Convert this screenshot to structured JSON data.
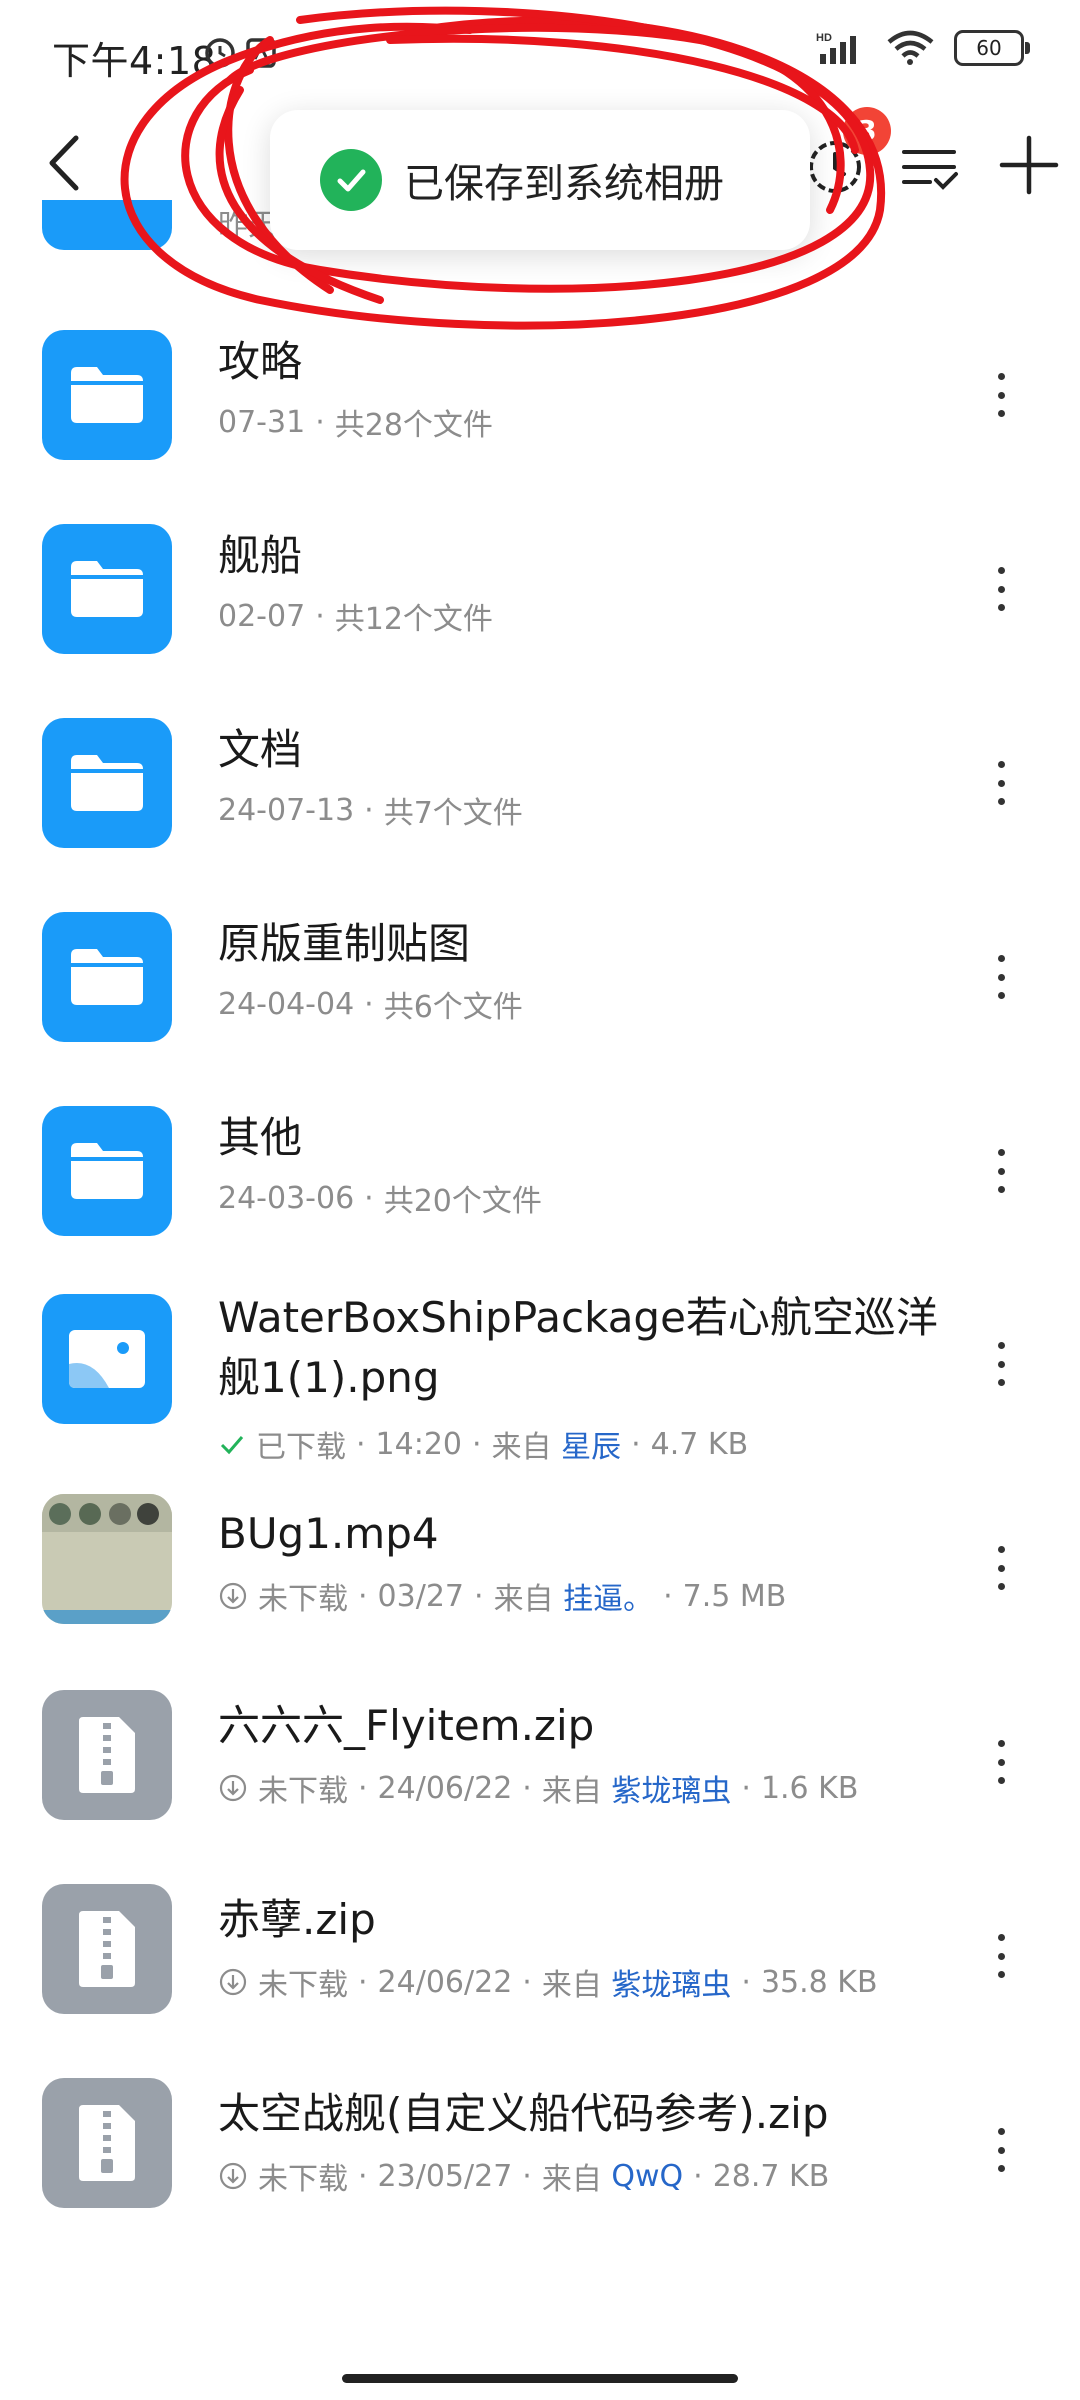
{
  "status_bar": {
    "time": "下午4:18",
    "battery": "60",
    "network_label": "HD"
  },
  "toast": {
    "text": "已保存到系统相册"
  },
  "topbar": {
    "history_badge": "3"
  },
  "partial_top_row": {
    "meta_fragment": "昨天"
  },
  "items": [
    {
      "kind": "folder",
      "title": "攻略",
      "date": "07-31",
      "count": "共28个文件"
    },
    {
      "kind": "folder",
      "title": "舰船",
      "date": "02-07",
      "count": "共12个文件"
    },
    {
      "kind": "folder",
      "title": "文档",
      "date": "24-07-13",
      "count": "共7个文件"
    },
    {
      "kind": "folder",
      "title": "原版重制贴图",
      "date": "24-04-04",
      "count": "共6个文件"
    },
    {
      "kind": "folder",
      "title": "其他",
      "date": "24-03-06",
      "count": "共20个文件"
    },
    {
      "kind": "image",
      "title": "WaterBoxShipPackage若心航空巡洋舰1(1).png",
      "status": "已下载",
      "time": "14:20",
      "from_label": "来自",
      "from": "星辰",
      "size": "4.7 KB"
    },
    {
      "kind": "video",
      "title": "BUg1.mp4",
      "status": "未下载",
      "time": "03/27",
      "from_label": "来自",
      "from": "挂逼。",
      "size": "7.5 MB"
    },
    {
      "kind": "zip",
      "title": "六六六_Flyitem.zip",
      "status": "未下载",
      "time": "24/06/22",
      "from_label": "来自",
      "from": "紫垅璃虫",
      "size": "1.6 KB"
    },
    {
      "kind": "zip",
      "title": "赤孽.zip",
      "status": "未下载",
      "time": "24/06/22",
      "from_label": "来自",
      "from": "紫垅璃虫",
      "size": "35.8 KB"
    },
    {
      "kind": "zip",
      "title": "太空战舰(自定义船代码参考).zip",
      "status": "未下载",
      "time": "23/05/27",
      "from_label": "来自",
      "from": "QwQ",
      "size": "28.7 KB"
    }
  ],
  "colors": {
    "folder": "#1a9bf9",
    "zip": "#9aa1aa",
    "link": "#2667c9",
    "success": "#22b35a",
    "badge": "#f24436",
    "annotation_red": "#e8151b"
  },
  "icons": [
    "back-icon",
    "history-clock-icon",
    "sort-icon",
    "add-icon",
    "folder-icon",
    "image-file-icon",
    "zip-file-icon",
    "more-vertical-icon",
    "check-icon",
    "download-icon"
  ]
}
